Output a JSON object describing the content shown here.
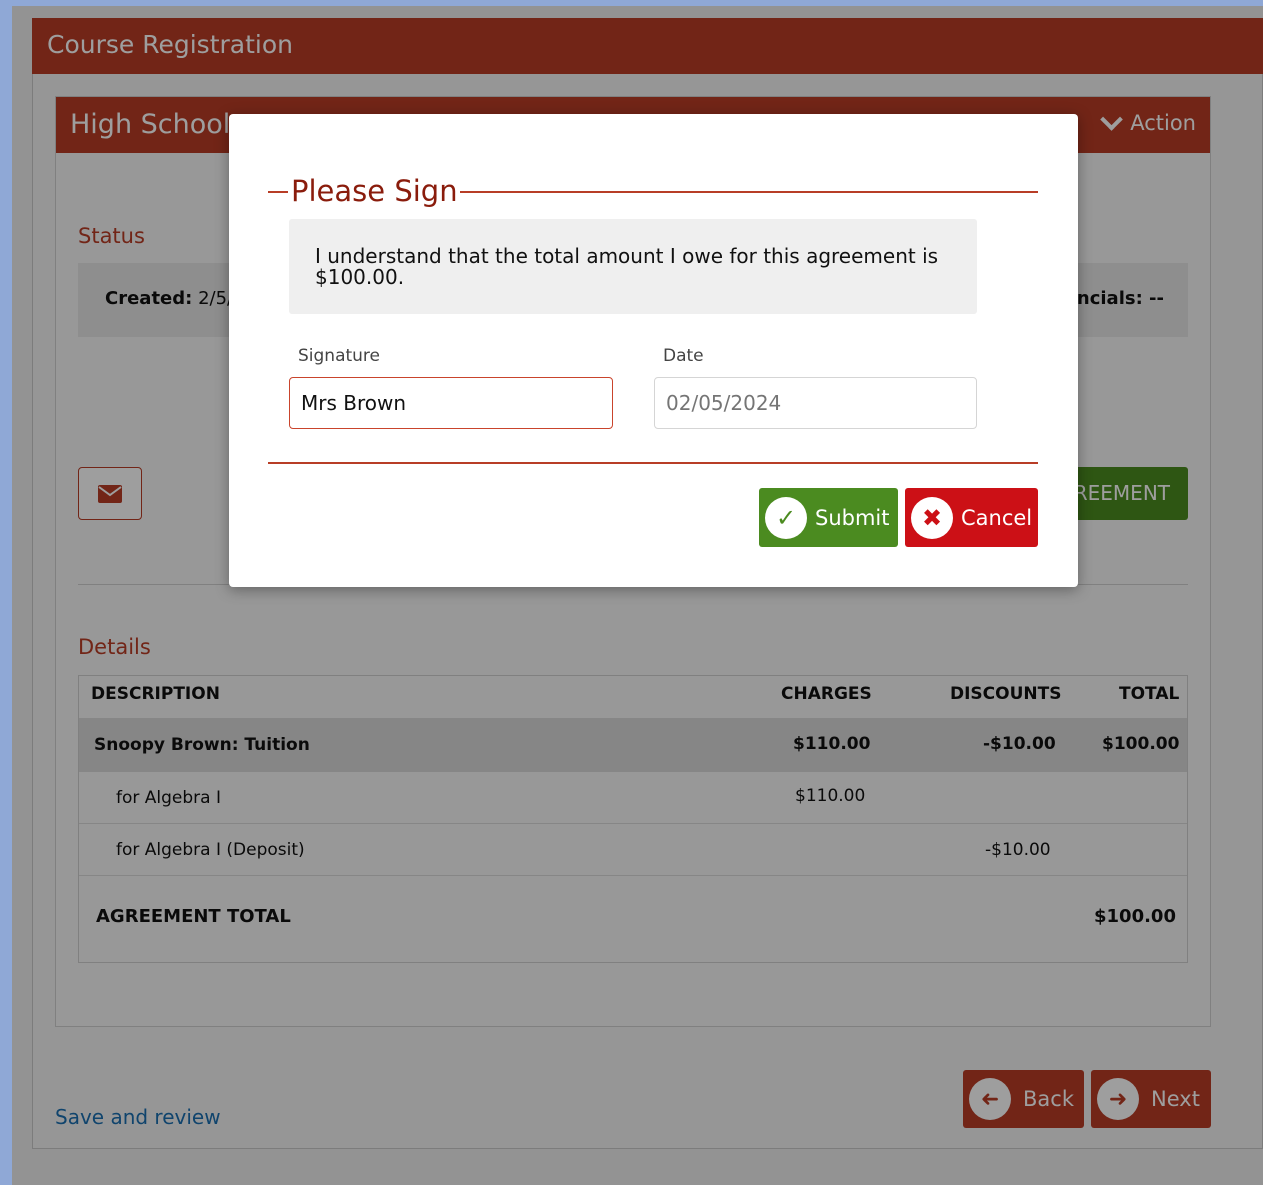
{
  "app": {
    "title": "Course Registration"
  },
  "card": {
    "title": "High School",
    "action_label": "Action"
  },
  "status": {
    "section_label": "Status",
    "created_label": "Created:",
    "created_value": "2/5/",
    "financials_text": "ncials: --"
  },
  "buttons": {
    "agreement_label": "REEMENT"
  },
  "details": {
    "section_label": "Details",
    "columns": [
      "DESCRIPTION",
      "CHARGES",
      "DISCOUNTS",
      "TOTAL"
    ],
    "main_row": {
      "description": "Snoopy Brown: Tuition",
      "charges": "$110.00",
      "discounts": "-$10.00",
      "total": "$100.00"
    },
    "sub_rows": [
      {
        "description": "for Algebra I",
        "charges": "$110.00",
        "discounts": "",
        "total": ""
      },
      {
        "description": "for Algebra I (Deposit)",
        "charges": "",
        "discounts": "-$10.00",
        "total": ""
      }
    ],
    "total_row": {
      "label": "AGREEMENT TOTAL",
      "total": "$100.00"
    }
  },
  "footer": {
    "save_review": "Save and review",
    "back_label": "Back",
    "next_label": "Next"
  },
  "modal": {
    "legend": "Please Sign",
    "agreement_text": "I understand that the total amount I owe for this agreement is $100.00.",
    "signature_label": "Signature",
    "signature_value": "Mrs Brown",
    "date_label": "Date",
    "date_placeholder": "02/05/2024",
    "submit_label": "Submit",
    "cancel_label": "Cancel"
  },
  "colors": {
    "brand": "#b83d26",
    "success": "#4b8b20",
    "danger": "#cc1016",
    "link": "#1a6fb0"
  }
}
